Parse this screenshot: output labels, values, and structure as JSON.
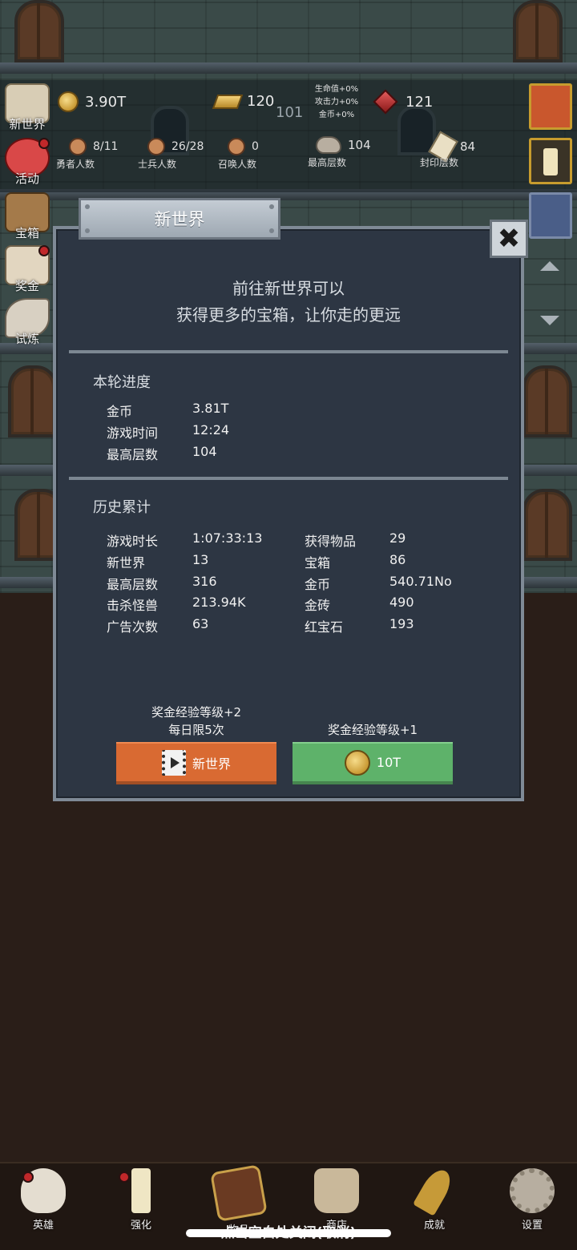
{
  "resources": {
    "gold": "3.90T",
    "gold_bars": "120",
    "level_badge": "101",
    "bonus_lines": [
      "生命值+0%",
      "攻击力+0%",
      "金币+0%"
    ],
    "rubies": "121"
  },
  "stats": [
    {
      "value": "8/11",
      "label": "勇者人数"
    },
    {
      "value": "26/28",
      "label": "士兵人数"
    },
    {
      "value": "0",
      "label": "召唤人数"
    },
    {
      "value": "104",
      "label": "最高层数"
    },
    {
      "value": "84",
      "label": "封印层数"
    }
  ],
  "side_left": [
    "新世界",
    "活动",
    "宝箱",
    "奖金",
    "试炼"
  ],
  "modal": {
    "title": "新世界",
    "close_glyph": "✖",
    "intro_line1": "前往新世界可以",
    "intro_line2": "获得更多的宝箱，让你走的更远",
    "current_section_title": "本轮进度",
    "current": [
      {
        "k": "金币",
        "v": "3.81T"
      },
      {
        "k": "游戏时间",
        "v": "12:24"
      },
      {
        "k": "最高层数",
        "v": "104"
      }
    ],
    "history_section_title": "历史累计",
    "history_left": [
      {
        "k": "游戏时长",
        "v": "1:07:33:13"
      },
      {
        "k": "新世界",
        "v": "13"
      },
      {
        "k": "最高层数",
        "v": "316"
      },
      {
        "k": "击杀怪兽",
        "v": "213.94K"
      },
      {
        "k": "广告次数",
        "v": "63"
      }
    ],
    "history_right": [
      {
        "k": "获得物品",
        "v": "29"
      },
      {
        "k": "宝箱",
        "v": "86"
      },
      {
        "k": "金币",
        "v": "540.71No"
      },
      {
        "k": "金砖",
        "v": "490"
      },
      {
        "k": "红宝石",
        "v": "193"
      }
    ],
    "ad_reward_line1": "奖金经验等级+2",
    "ad_reward_line2": "每日限5次",
    "ad_button_label": "新世界",
    "coin_reward_line": "奖金经验等级+1",
    "coin_button_label": "10T"
  },
  "bottom_nav": [
    "英雄",
    "强化",
    "物品",
    "商店",
    "成就",
    "设置"
  ],
  "close_hint": "点击空白处关闭(取消)"
}
